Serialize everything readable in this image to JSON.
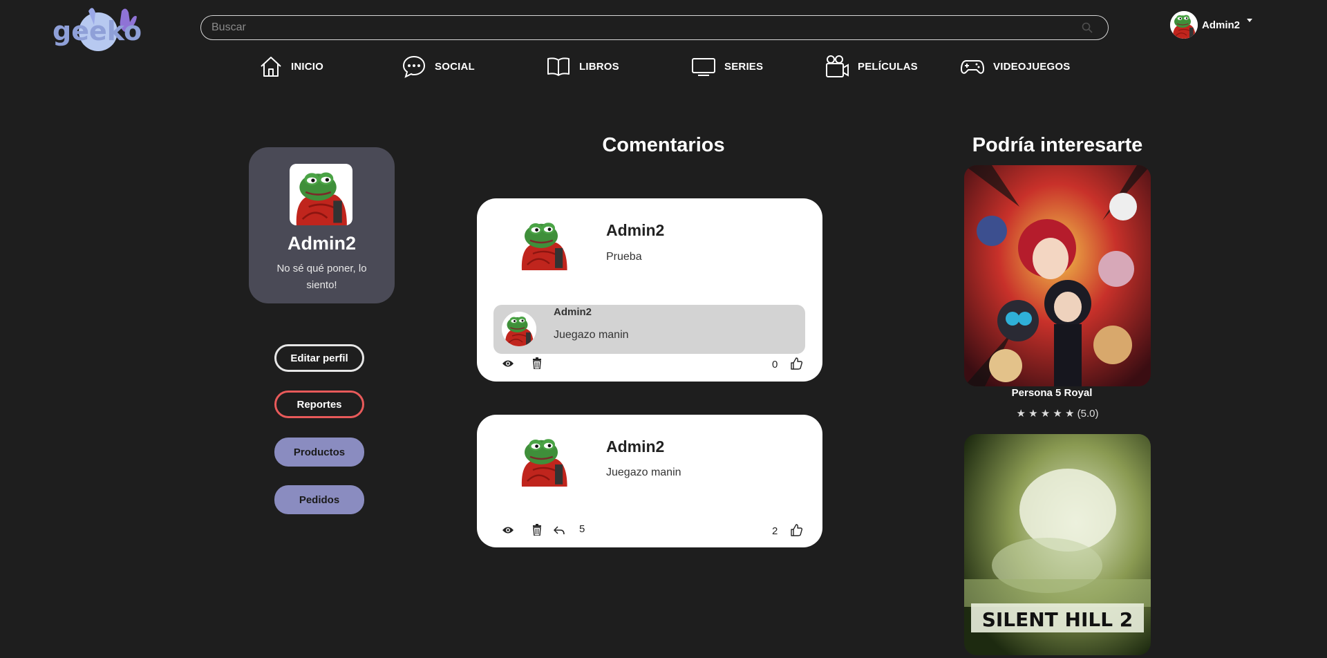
{
  "header": {
    "logo_text": "geeko",
    "search": {
      "placeholder": "Buscar",
      "value": ""
    },
    "user": {
      "name": "Admin2"
    }
  },
  "nav": [
    {
      "label": "INICIO",
      "icon": "home-icon"
    },
    {
      "label": "SOCIAL",
      "icon": "chat-bubble-icon"
    },
    {
      "label": "LIBROS",
      "icon": "book-icon"
    },
    {
      "label": "SERIES",
      "icon": "tv-icon"
    },
    {
      "label": "PELÍCULAS",
      "icon": "movie-camera-icon"
    },
    {
      "label": "VIDEOJUEGOS",
      "icon": "gamepad-icon"
    }
  ],
  "profile": {
    "name": "Admin2",
    "bio": "No sé qué poner, lo siento!",
    "buttons": {
      "edit": "Editar perfil",
      "reports": "Reportes",
      "products": "Productos",
      "orders": "Pedidos"
    }
  },
  "comments": {
    "title": "Comentarios",
    "items": [
      {
        "author": "Admin2",
        "text": "Prueba",
        "reply": {
          "author": "Admin2",
          "text": "Juegazo manin"
        },
        "likes": "0"
      },
      {
        "author": "Admin2",
        "text": "Juegazo manin",
        "replies": "5",
        "likes": "2"
      }
    ]
  },
  "recommendations": {
    "title": "Podría interesarte",
    "items": [
      {
        "name": "Persona 5 Royal",
        "rating": "★ ★ ★ ★ ★ (5.0)"
      },
      {
        "name": "",
        "cover_text": "SILENT HILL 2"
      }
    ]
  },
  "colors": {
    "background": "#1e1e1e",
    "profile_card": "#4a4a56",
    "button_accent": "#8a8cc0",
    "report_red": "#e85a5a"
  }
}
